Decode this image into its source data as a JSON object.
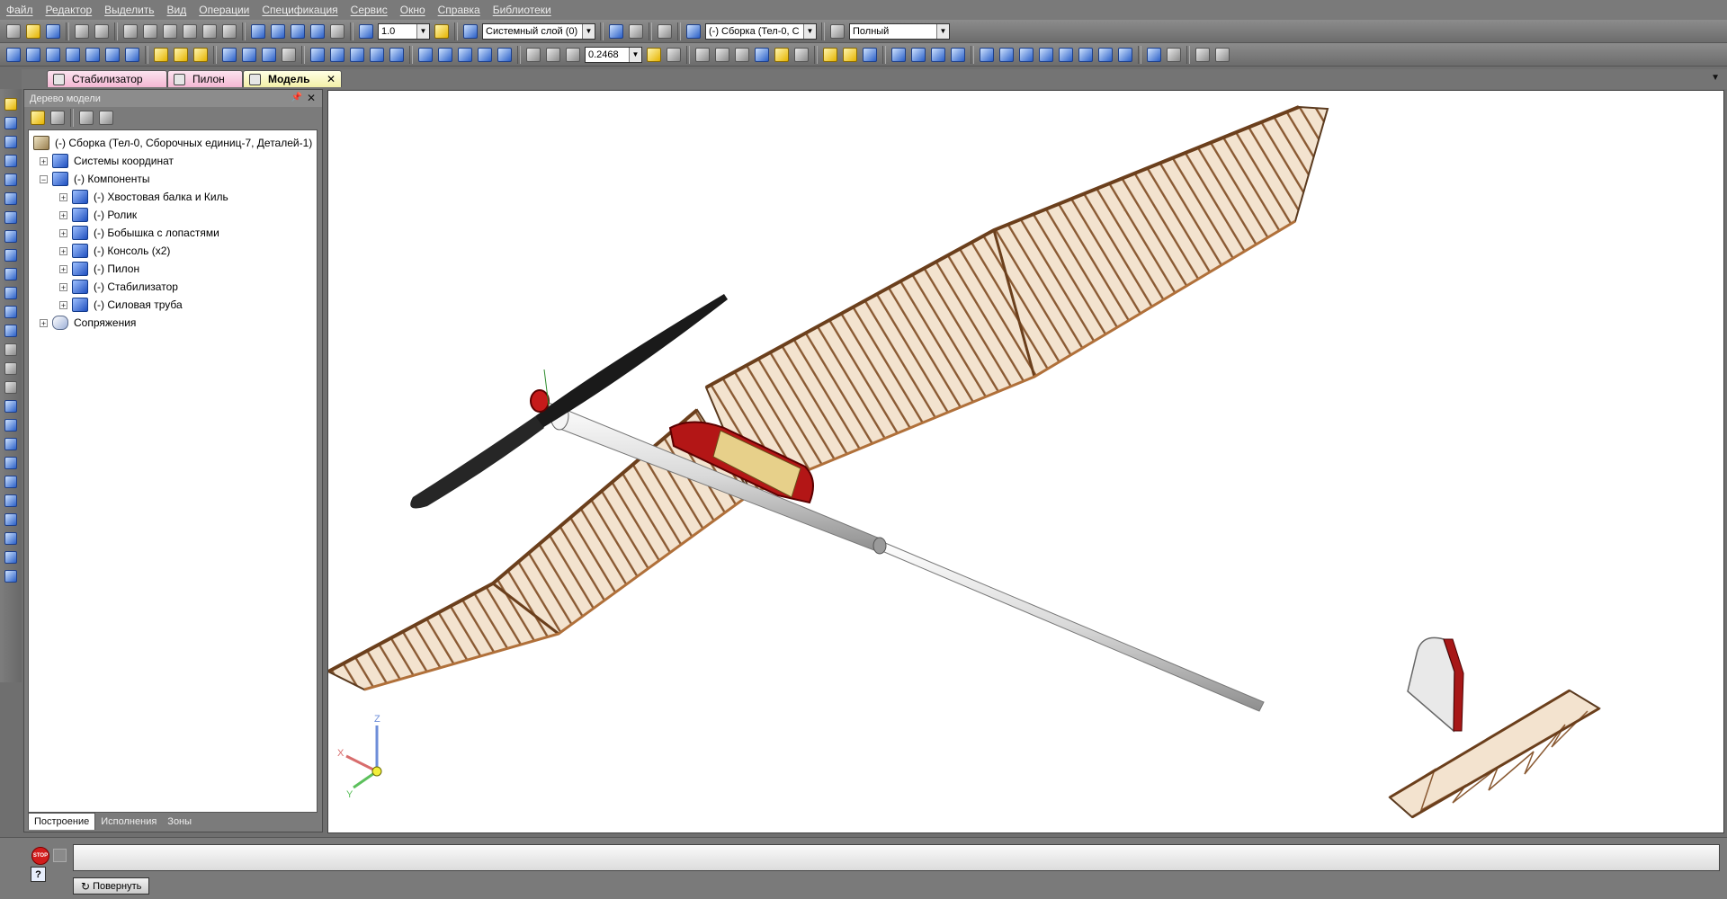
{
  "menu": [
    "Файл",
    "Редактор",
    "Выделить",
    "Вид",
    "Операции",
    "Спецификация",
    "Сервис",
    "Окно",
    "Справка",
    "Библиотеки"
  ],
  "toolbar": {
    "step_value": "1.0",
    "layer_value": "Системный слой (0)",
    "assembly_value": "(-) Сборка (Тел-0, С",
    "view_mode_value": "Полный",
    "zoom_value": "0.2468"
  },
  "doc_tabs": [
    {
      "label": "Стабилизатор",
      "active": false
    },
    {
      "label": "Пилон",
      "active": false
    },
    {
      "label": "Модель",
      "active": true
    }
  ],
  "tree": {
    "title": "Дерево модели",
    "root": "(-) Сборка (Тел-0, Сборочных единиц-7, Деталей-1)",
    "coords": "Системы координат",
    "components": "(-) Компоненты",
    "items": [
      "(-) Хвостовая балка и Киль",
      "(-) Ролик",
      "(-) Бобышка с лопастями",
      "(-) Консоль (x2)",
      "(-) Пилон",
      "(-) Стабилизатор",
      "(-) Силовая труба"
    ],
    "mates": "Сопряжения",
    "tabs": [
      "Построение",
      "Исполнения",
      "Зоны"
    ]
  },
  "axes": {
    "x": "X",
    "y": "Y",
    "z": "Z"
  },
  "status": {
    "rotate_label": "Повернуть",
    "stop_label": "STOP",
    "help_label": "?"
  },
  "icons": [
    "stop-icon",
    "help-icon",
    "rotate-icon",
    "model-tree-icon",
    "pin-icon",
    "close-icon"
  ]
}
